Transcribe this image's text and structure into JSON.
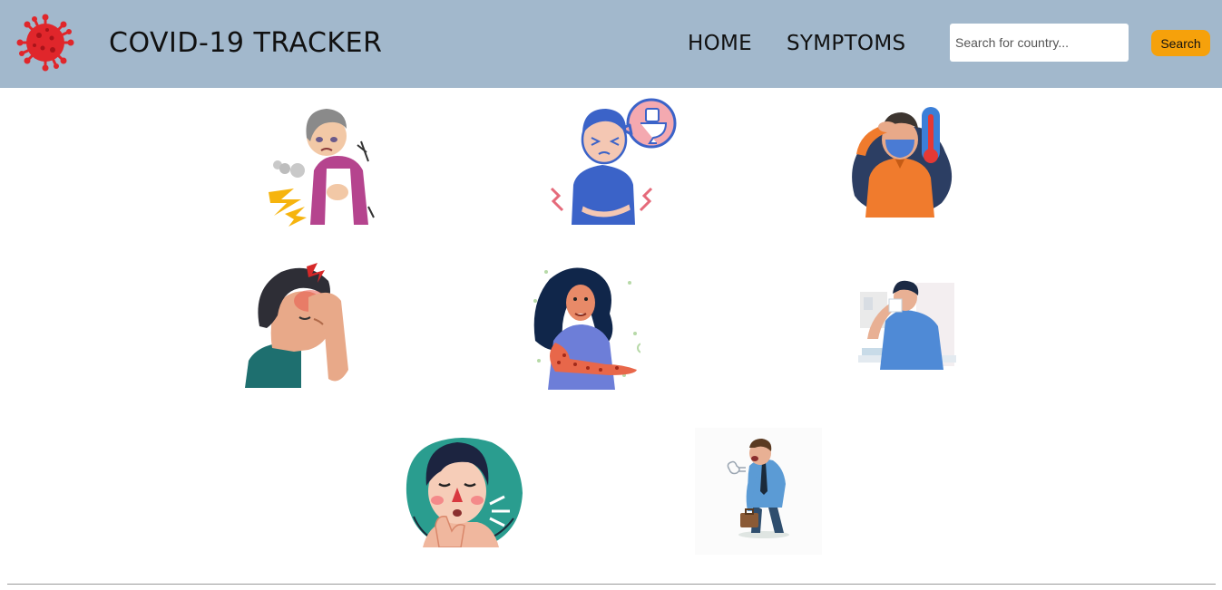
{
  "header": {
    "brand": "COVID-19 TRACKER",
    "logo_icon": "coronavirus-icon",
    "nav": [
      {
        "label": "HOME"
      },
      {
        "label": "SYMPTOMS"
      }
    ],
    "search": {
      "placeholder": "Search for country...",
      "value": "",
      "button_label": "Search"
    },
    "colors": {
      "navbar": "#a2b8cc",
      "button": "#f6a10b",
      "virus": "#e0262b"
    }
  },
  "symptoms": [
    {
      "icon": "shortness-of-breath-illustration"
    },
    {
      "icon": "diarrhea-illustration"
    },
    {
      "icon": "fever-illustration"
    },
    {
      "icon": "headache-illustration"
    },
    {
      "icon": "skin-rash-illustration"
    },
    {
      "icon": "runny-nose-illustration"
    },
    {
      "icon": "sore-throat-illustration"
    },
    {
      "icon": "fatigue-illustration"
    }
  ]
}
